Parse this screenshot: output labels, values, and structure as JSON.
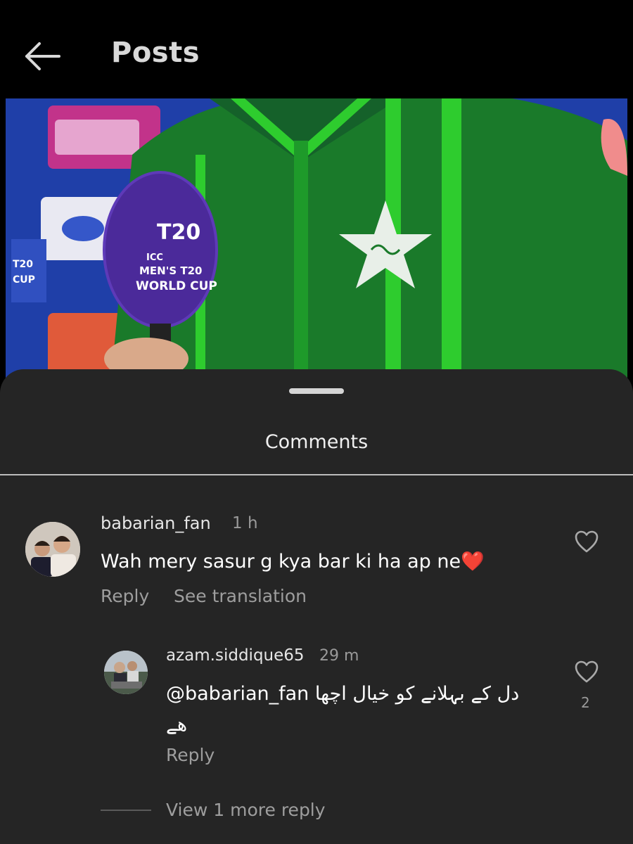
{
  "header": {
    "title": "Posts",
    "back_icon": "arrow-left-icon"
  },
  "post_image": {
    "description_icon": "photo",
    "mic_text_line1": "ICC",
    "mic_text_line2": "MEN'S T20",
    "mic_text_line3": "WORLD CUP",
    "mic_logo": "T20",
    "left_board_line1": "T20",
    "left_board_line2": "CUP",
    "colors": {
      "jersey": "#1a7a2a",
      "stripe": "#2ecc2e",
      "mic": "#4b2a9a",
      "backdrop": "#1f3fa8"
    }
  },
  "comments_sheet": {
    "title": "Comments"
  },
  "comments": [
    {
      "username": "babarian_fan",
      "time": "1 h",
      "text": "Wah mery sasur g kya bar ki ha ap ne",
      "emoji": "❤️",
      "reply_label": "Reply",
      "translate_label": "See translation",
      "like_icon": "heart-outline-icon"
    }
  ],
  "replies": [
    {
      "username": "azam.siddique65",
      "time": "29 m",
      "mention": "@babarian_fan",
      "text_line1": "دل کے بہلانے کو خیال اچھا",
      "text_line2": "ھے",
      "reply_label": "Reply",
      "like_icon": "heart-outline-icon",
      "like_count": "2"
    }
  ],
  "view_more": {
    "label": "View 1 more reply"
  }
}
